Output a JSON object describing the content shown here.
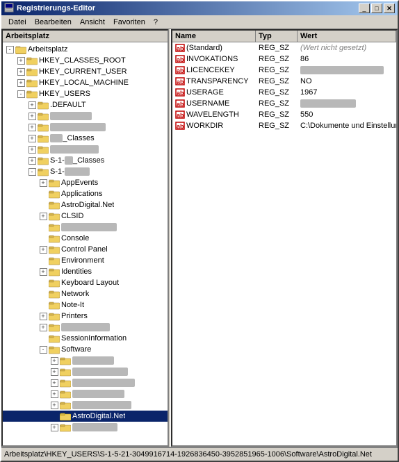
{
  "window": {
    "title": "Registrierungs-Editor",
    "minimize_label": "_",
    "maximize_label": "□",
    "close_label": "✕"
  },
  "menu": {
    "items": [
      "Datei",
      "Bearbeiten",
      "Ansicht",
      "Favoriten",
      "?"
    ]
  },
  "tree": {
    "header": "Arbeitsplatz",
    "items": [
      {
        "id": "arbeitsplatz",
        "label": "Arbeitsplatz",
        "level": 0,
        "expanded": true,
        "type": "root"
      },
      {
        "id": "hkcr",
        "label": "HKEY_CLASSES_ROOT",
        "level": 1,
        "expanded": false,
        "type": "folder"
      },
      {
        "id": "hkcu",
        "label": "HKEY_CURRENT_USER",
        "level": 1,
        "expanded": false,
        "type": "folder"
      },
      {
        "id": "hklm",
        "label": "HKEY_LOCAL_MACHINE",
        "level": 1,
        "expanded": false,
        "type": "folder"
      },
      {
        "id": "hku",
        "label": "HKEY_USERS",
        "level": 1,
        "expanded": true,
        "type": "folder"
      },
      {
        "id": "default",
        "label": ".DEFAULT",
        "level": 2,
        "expanded": false,
        "type": "folder"
      },
      {
        "id": "s_blank1",
        "label": "S-███████",
        "level": 2,
        "expanded": false,
        "type": "folder",
        "censored": true
      },
      {
        "id": "s_blank2",
        "label": "S-████████████",
        "level": 2,
        "expanded": false,
        "type": "folder",
        "censored": true
      },
      {
        "id": "s_classes1",
        "label": "S-████_Classes",
        "level": 2,
        "expanded": false,
        "type": "folder",
        "censored": true
      },
      {
        "id": "s_blank3",
        "label": "S-1-████████",
        "level": 2,
        "expanded": false,
        "type": "folder",
        "censored": true
      },
      {
        "id": "s_classes2",
        "label": "S-1-███_Classes",
        "level": 2,
        "expanded": false,
        "type": "folder",
        "censored": true
      },
      {
        "id": "s1_main",
        "label": "S-1-█████████████",
        "level": 2,
        "expanded": true,
        "type": "folder",
        "censored": true
      },
      {
        "id": "appevents",
        "label": "AppEvents",
        "level": 3,
        "expanded": false,
        "type": "folder"
      },
      {
        "id": "applications",
        "label": "Applications",
        "level": 3,
        "expanded": false,
        "type": "folder"
      },
      {
        "id": "astrodigital",
        "label": "AstroDigital.Net",
        "level": 3,
        "expanded": false,
        "type": "folder"
      },
      {
        "id": "clsid",
        "label": "CLSID",
        "level": 3,
        "expanded": false,
        "type": "folder"
      },
      {
        "id": "console_blank",
        "label": "████████",
        "level": 3,
        "expanded": false,
        "type": "folder",
        "censored": true
      },
      {
        "id": "console",
        "label": "Console",
        "level": 3,
        "expanded": false,
        "type": "folder"
      },
      {
        "id": "controlpanel",
        "label": "Control Panel",
        "level": 3,
        "expanded": false,
        "type": "folder"
      },
      {
        "id": "environment",
        "label": "Environment",
        "level": 3,
        "expanded": false,
        "type": "folder"
      },
      {
        "id": "identities",
        "label": "Identities",
        "level": 3,
        "expanded": false,
        "type": "folder"
      },
      {
        "id": "keyboardlayout",
        "label": "Keyboard Layout",
        "level": 3,
        "expanded": false,
        "type": "folder"
      },
      {
        "id": "network",
        "label": "Network",
        "level": 3,
        "expanded": false,
        "type": "folder"
      },
      {
        "id": "noteit",
        "label": "Note-It",
        "level": 3,
        "expanded": false,
        "type": "folder"
      },
      {
        "id": "printers",
        "label": "Printers",
        "level": 3,
        "expanded": false,
        "type": "folder"
      },
      {
        "id": "printers_blank",
        "label": "████████",
        "level": 3,
        "expanded": false,
        "type": "folder",
        "censored": true
      },
      {
        "id": "sessioninfo",
        "label": "SessionInformation",
        "level": 3,
        "expanded": false,
        "type": "folder"
      },
      {
        "id": "software",
        "label": "Software",
        "level": 3,
        "expanded": true,
        "type": "folder"
      },
      {
        "id": "sw1",
        "label": "████████",
        "level": 4,
        "expanded": false,
        "type": "folder",
        "censored": true
      },
      {
        "id": "sw2",
        "label": "████████████",
        "level": 4,
        "expanded": false,
        "type": "folder",
        "censored": true
      },
      {
        "id": "sw3",
        "label": "████████████",
        "level": 4,
        "expanded": false,
        "type": "folder",
        "censored": true
      },
      {
        "id": "sw4",
        "label": "████████████",
        "level": 4,
        "expanded": false,
        "type": "folder",
        "censored": true
      },
      {
        "id": "sw5",
        "label": "████████████",
        "level": 4,
        "expanded": false,
        "type": "folder",
        "censored": true
      },
      {
        "id": "astrodigital_sw",
        "label": "AstroDigital.Net",
        "level": 4,
        "expanded": false,
        "type": "folder",
        "selected": true
      },
      {
        "id": "sw6",
        "label": "████████",
        "level": 4,
        "expanded": false,
        "type": "folder",
        "censored": true
      }
    ]
  },
  "registry": {
    "columns": [
      "Name",
      "Typ",
      "Wert"
    ],
    "rows": [
      {
        "name": "(Standard)",
        "type": "REG_SZ",
        "value": "(Wert nicht gesetzt)"
      },
      {
        "name": "INVOKATIONS",
        "type": "REG_SZ",
        "value": "86"
      },
      {
        "name": "LICENCEKEY",
        "type": "REG_SZ",
        "value": "████████████████████"
      },
      {
        "name": "TRANSPARENCY",
        "type": "REG_SZ",
        "value": "NO"
      },
      {
        "name": "USERAGE",
        "type": "REG_SZ",
        "value": "1967"
      },
      {
        "name": "USERNAME",
        "type": "REG_SZ",
        "value": "████████████"
      },
      {
        "name": "WAVELENGTH",
        "type": "REG_SZ",
        "value": "550"
      },
      {
        "name": "WORKDIR",
        "type": "REG_SZ",
        "value": "C:\\Dokumente und Einstellung"
      }
    ]
  },
  "status_bar": {
    "text": "Arbeitsplatz\\HKEY_USERS\\S-1-5-21-3049916714-1926836450-3952851965-1006\\Software\\AstroDigital.Net"
  }
}
